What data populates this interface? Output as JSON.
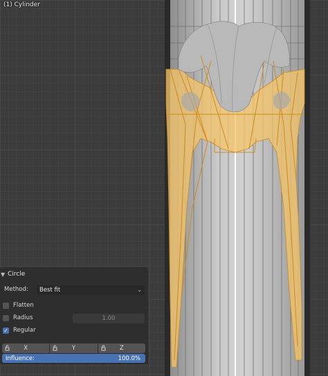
{
  "viewport": {
    "object_name": "(1) Cylinder"
  },
  "panel": {
    "title": "Circle",
    "method_label": "Method:",
    "method_value": "Best fit",
    "flatten_label": "Flatten",
    "flatten_checked": false,
    "radius_label": "Radius",
    "radius_checked": false,
    "radius_value": "1.00",
    "regular_label": "Regular",
    "regular_checked": true,
    "lock_axes": [
      "X",
      "Y",
      "Z"
    ],
    "influence_label": "Influence:",
    "influence_value": "100.0%"
  },
  "colors": {
    "accent": "#4772b3",
    "mesh_selected": "#f0c060",
    "mesh": "#b8b8b8"
  }
}
